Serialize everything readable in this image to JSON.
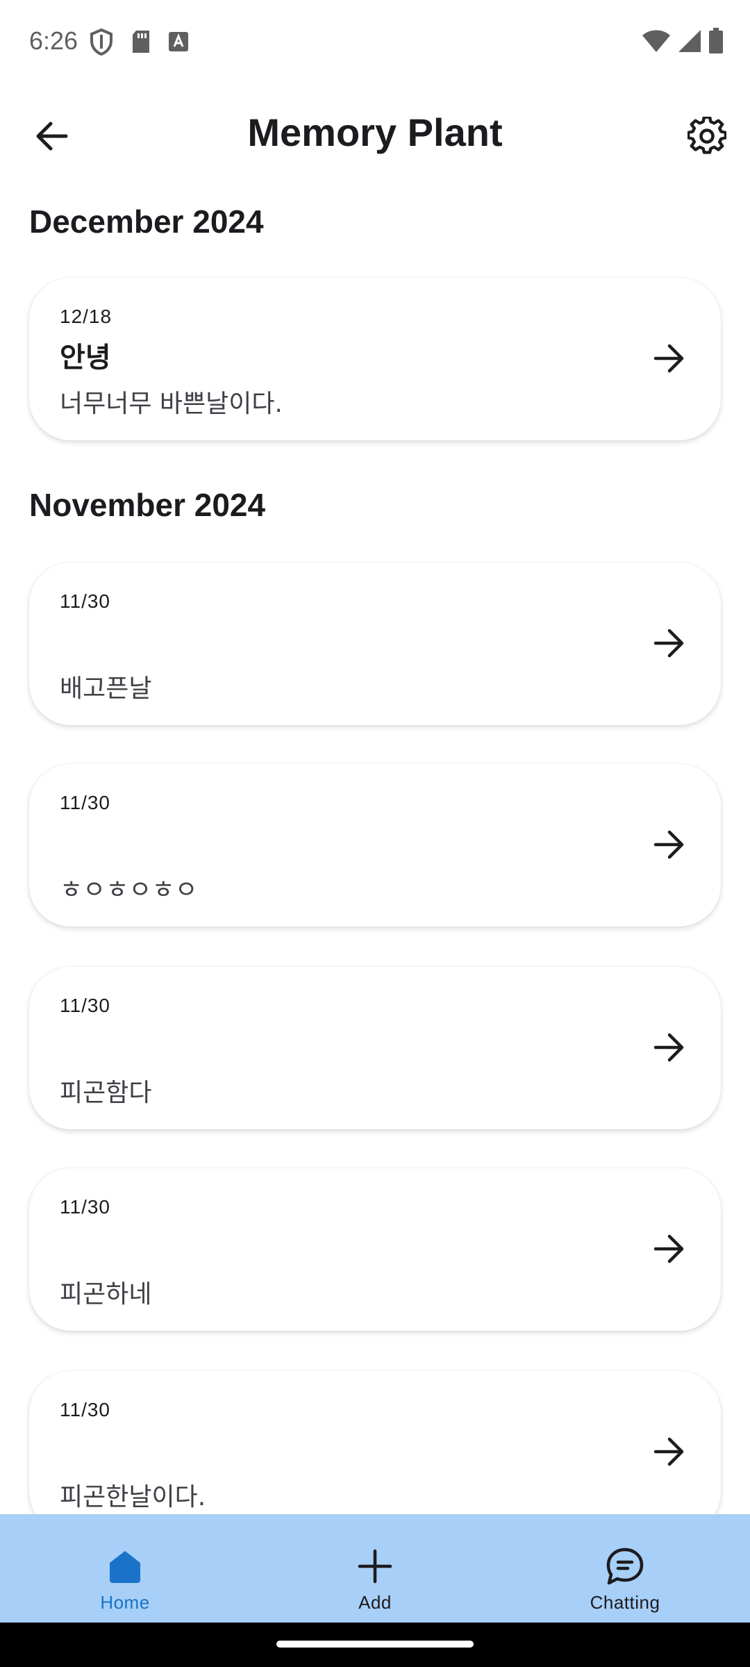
{
  "status_bar": {
    "time": "6:26",
    "left_icons": [
      "shield-icon",
      "sd-card-icon",
      "keyboard-a-icon"
    ],
    "right_icons": [
      "wifi-icon",
      "signal-icon",
      "battery-icon"
    ]
  },
  "app_bar": {
    "title": "Memory Plant",
    "back_icon": "arrow-left-icon",
    "settings_icon": "gear-icon"
  },
  "sections": [
    {
      "month": "December 2024",
      "entries": [
        {
          "date": "12/18",
          "title": "안녕",
          "body": "너무너무 바쁜날이다."
        }
      ]
    },
    {
      "month": "November 2024",
      "entries": [
        {
          "date": "11/30",
          "title": "",
          "body": "배고픈날"
        },
        {
          "date": "11/30",
          "title": "",
          "body": "ㅎㅇㅎㅇㅎㅇ"
        },
        {
          "date": "11/30",
          "title": "",
          "body": "피곤함다"
        },
        {
          "date": "11/30",
          "title": "",
          "body": "피곤하네"
        },
        {
          "date": "11/30",
          "title": "",
          "body": "피곤한날이다."
        }
      ]
    }
  ],
  "bottom_nav": {
    "items": [
      {
        "label": "Home",
        "icon": "home-icon",
        "active": true
      },
      {
        "label": "Add",
        "icon": "plus-icon",
        "active": false
      },
      {
        "label": "Chatting",
        "icon": "chat-bubble-icon",
        "active": false
      }
    ]
  },
  "colors": {
    "nav_background": "#a7cff7",
    "nav_active": "#1a73c8",
    "card_background": "#ffffff",
    "text_primary": "#1c1b1f"
  }
}
